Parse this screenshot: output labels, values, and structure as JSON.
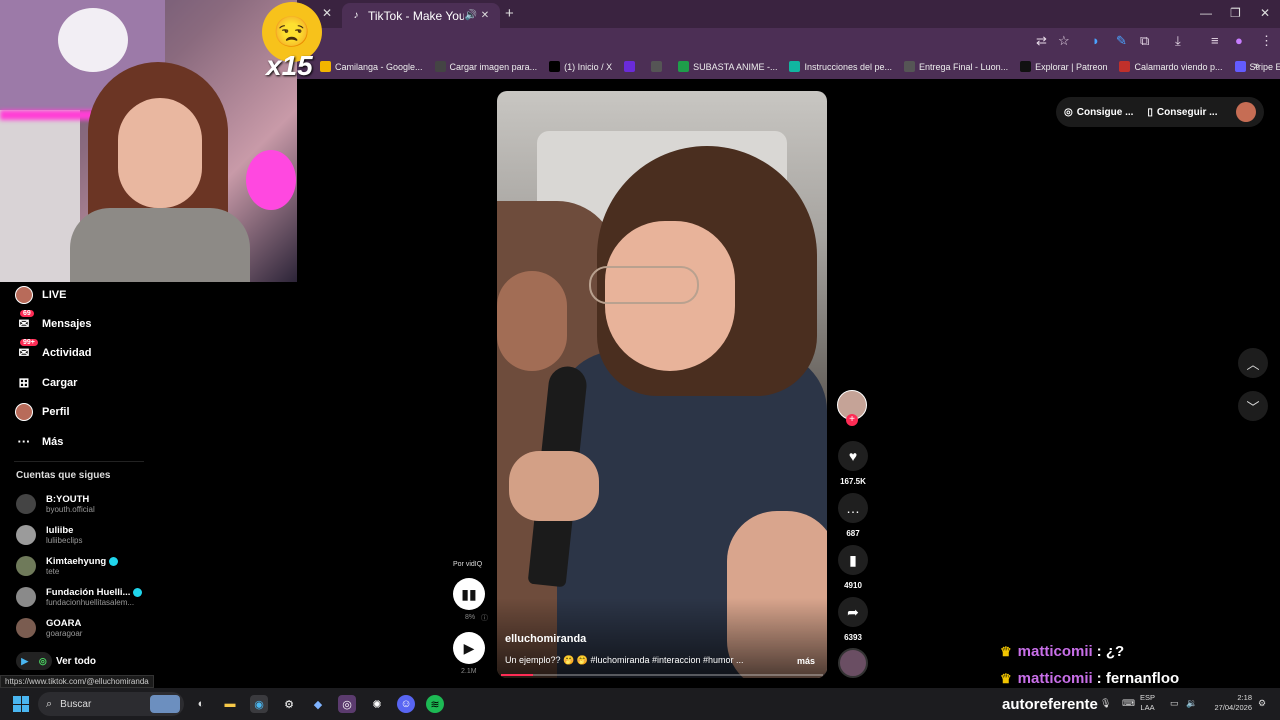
{
  "browser": {
    "active_tab_title": "TikTok - Make Your Day",
    "bookmarks": [
      {
        "label": "Camilanga - Google...",
        "color": "#f2b400"
      },
      {
        "label": "Cargar imagen para...",
        "color": "#444444"
      },
      {
        "label": "(1) Inicio / X",
        "color": "#000000"
      },
      {
        "label": "",
        "color": "#6a2bd9"
      },
      {
        "label": "",
        "color": "#555555"
      },
      {
        "label": "SUBASTA ANIME -...",
        "color": "#1e9e4a"
      },
      {
        "label": "Instrucciones del pe...",
        "color": "#11b6a0"
      },
      {
        "label": "Entrega Final - Luon...",
        "color": "#555555"
      },
      {
        "label": "Explorar | Patreon",
        "color": "#111111"
      },
      {
        "label": "Calamardo viendo p...",
        "color": "#c0302b"
      },
      {
        "label": "Stripe Express",
        "color": "#635bff"
      }
    ]
  },
  "overlay": {
    "multiplier": "x15"
  },
  "sidebar": {
    "nav": [
      {
        "label": "LIVE",
        "icon": "live-avatar-icon",
        "badge": ""
      },
      {
        "label": "Mensajes",
        "icon": "inbox-icon",
        "badge": "69"
      },
      {
        "label": "Actividad",
        "icon": "activity-icon",
        "badge": "99+"
      },
      {
        "label": "Cargar",
        "icon": "upload-icon",
        "badge": ""
      },
      {
        "label": "Perfil",
        "icon": "profile-avatar-icon",
        "badge": ""
      },
      {
        "label": "Más",
        "icon": "more-icon",
        "badge": ""
      }
    ],
    "following_title": "Cuentas que sigues",
    "following": [
      {
        "name": "B:YOUTH",
        "handle": "byouth.official",
        "verified": false
      },
      {
        "name": "luliibe",
        "handle": "luliibeclips",
        "verified": false
      },
      {
        "name": "Kimtaehyung",
        "handle": "tete",
        "verified": true
      },
      {
        "name": "Fundación Huelli...",
        "handle": "fundacionhuellitasalem...",
        "verified": true
      },
      {
        "name": "GOARA",
        "handle": "goaragoar",
        "verified": false
      }
    ],
    "see_all": "Ver todo",
    "status_url": "https://www.tiktok.com/@elluchomiranda"
  },
  "video": {
    "username": "elluchomiranda",
    "caption": "Un ejemplo?? 🤭 🤭 #luchomiranda #interaccion #humor ...",
    "more_label": "más",
    "progress": 0.1
  },
  "vidiq": {
    "by_label": "Por vidIQ",
    "stat_percent": "8%",
    "views": "2.1M"
  },
  "actions": {
    "likes": "167.5K",
    "comments": "687",
    "saves": "4910",
    "shares": "6393"
  },
  "header": {
    "coins_label": "Consigue ...",
    "app_label": "Conseguir ..."
  },
  "chat": [
    {
      "user": "matticomii",
      "message": ": ¿?"
    },
    {
      "user": "matticomii",
      "message": ": fernanfloo"
    }
  ],
  "taskbar": {
    "search_placeholder": "Buscar",
    "stream_text": "autoreferente",
    "lang_line1": "ESP",
    "lang_line2": "LAA",
    "time": "2:18",
    "date": "27/04/2026"
  },
  "colors": {
    "tiktok_accent": "#fe2c55",
    "browser_frame": "#4c2f55",
    "chat_name": "#c86fe8"
  }
}
